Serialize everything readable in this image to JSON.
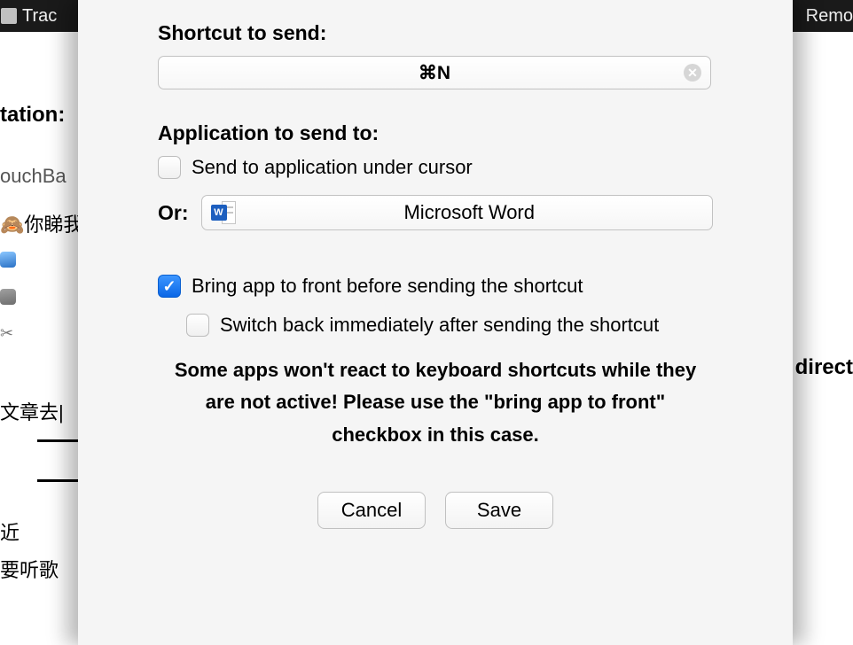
{
  "topbar": {
    "left_text": "Trac",
    "right_text": "Remo"
  },
  "background": {
    "tation_label": "tation:",
    "ouchba_label": "ouchBa",
    "row1": "🙈你睇我",
    "scissors": "✂",
    "direct_label": "direct",
    "row2": "文章去|",
    "row3": "近",
    "row4": "要听歌"
  },
  "sheet": {
    "shortcut_header": "Shortcut to send:",
    "shortcut_value": "⌘N",
    "app_header": "Application to send to:",
    "send_under_cursor_label": "Send to application under cursor",
    "or_label": "Or:",
    "app_name": "Microsoft Word",
    "bring_front_label": "Bring app to front before sending the shortcut",
    "switch_back_label": "Switch back immediately after sending the shortcut",
    "note": "Some apps won't react to keyboard shortcuts while they are not active! Please use the \"bring app to front\" checkbox in this case.",
    "cancel": "Cancel",
    "save": "Save"
  }
}
